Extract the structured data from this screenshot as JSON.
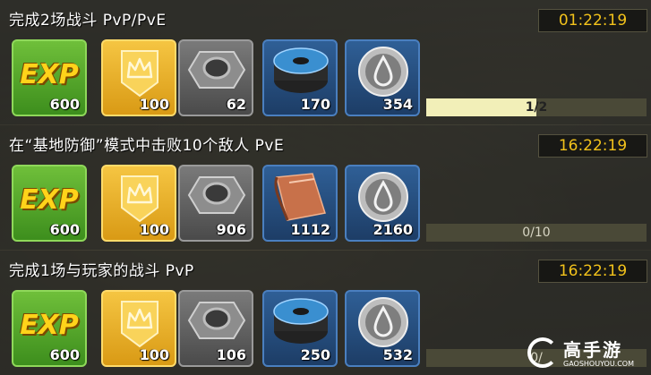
{
  "quests": [
    {
      "title": "完成2场战斗 PvP/PvE",
      "timer": "01:22:19",
      "rewards": {
        "exp": "600",
        "crown": "100",
        "nut": "62",
        "material": "170",
        "fuel": "354"
      },
      "progress_text": "1/2",
      "progress_fraction": 0.5,
      "material_kind": "blue-wire-spool"
    },
    {
      "title": "在“基地防御”模式中击败10个敌人 PvE",
      "timer": "16:22:19",
      "rewards": {
        "exp": "600",
        "crown": "100",
        "nut": "906",
        "material": "1112",
        "fuel": "2160"
      },
      "progress_text": "0/10",
      "progress_fraction": 0,
      "material_kind": "copper-sheet"
    },
    {
      "title": "完成1场与玩家的战斗 PvP",
      "timer": "16:22:19",
      "rewards": {
        "exp": "600",
        "crown": "100",
        "nut": "106",
        "material": "250",
        "fuel": "532"
      },
      "progress_text": "0/",
      "progress_fraction": 0,
      "material_kind": "blue-wire-spool"
    }
  ],
  "exp_label": "EXP",
  "watermark": {
    "text": "高手游",
    "sub": "GAOSHOUYOU.COM"
  },
  "colors": {
    "timer": "#f2c21b",
    "exp_bg": "#4fa52a",
    "crown_bg": "#eab42c",
    "material_bg": "#28527f"
  }
}
